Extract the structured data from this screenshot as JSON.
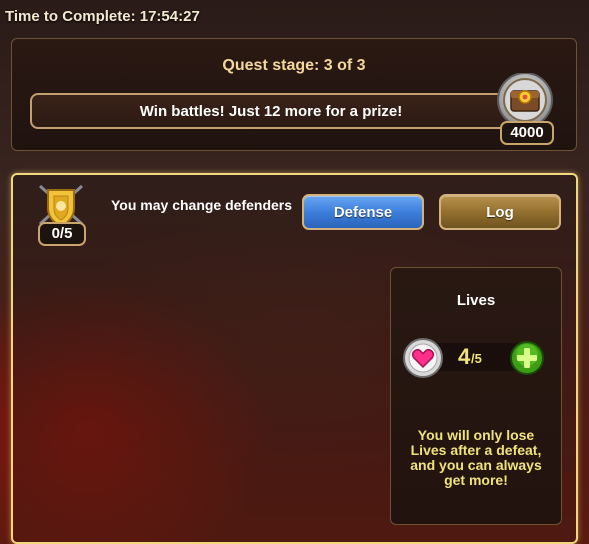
{
  "timer": {
    "label": "Time to Complete:",
    "value": "17:54:27"
  },
  "quest": {
    "stage_title": "Quest stage: 3 of 3",
    "task_text": "Win battles! Just 12 more for a prize!",
    "prize_amount": "4000",
    "prize_icon": "chest-icon"
  },
  "defense": {
    "defenders_count": "0/5",
    "change_text": "You may change defenders",
    "shield_icon": "shield-icon",
    "defense_button": "Defense",
    "log_button": "Log"
  },
  "lives": {
    "title": "Lives",
    "current": "4",
    "max": "/5",
    "heart_icon": "heart-icon",
    "add_icon": "plus-icon",
    "note": "You will only lose Lives after a defeat, and you can always get more!"
  },
  "colors": {
    "gold_border": "#f3d77c",
    "defense_blue": "#3d7fdc",
    "log_bronze": "#94702f",
    "lives_text": "#f0e37a",
    "plus_green": "#4fb81c"
  }
}
